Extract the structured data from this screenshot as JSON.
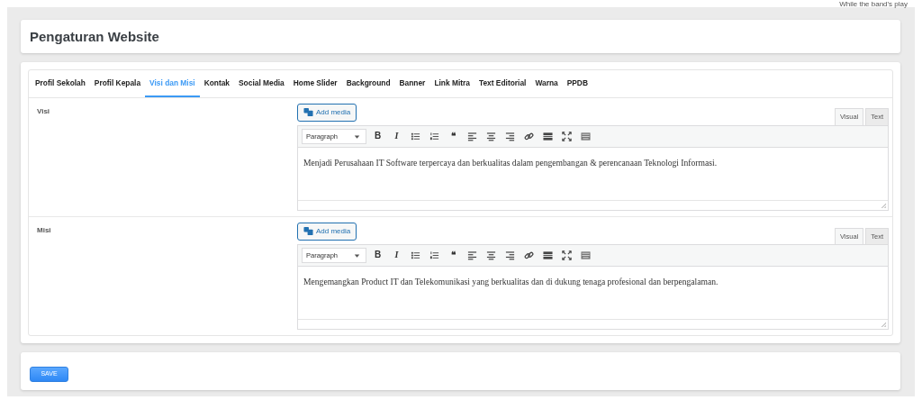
{
  "corner_note": "While the band's play",
  "header": {
    "title": "Pengaturan Website"
  },
  "tabs": [
    {
      "label": "Profil Sekolah",
      "selected": false
    },
    {
      "label": "Profil Kepala",
      "selected": false
    },
    {
      "label": "Visi dan Misi",
      "selected": true
    },
    {
      "label": "Kontak",
      "selected": false
    },
    {
      "label": "Social Media",
      "selected": false
    },
    {
      "label": "Home Slider",
      "selected": false
    },
    {
      "label": "Background",
      "selected": false
    },
    {
      "label": "Banner",
      "selected": false
    },
    {
      "label": "Link Mitra",
      "selected": false
    },
    {
      "label": "Text Editorial",
      "selected": false
    },
    {
      "label": "Warna",
      "selected": false
    },
    {
      "label": "PPDB",
      "selected": false
    }
  ],
  "fields": [
    {
      "label": "Visi",
      "add_media": "Add media",
      "format": "Paragraph",
      "modes": [
        {
          "label": "Visual",
          "selected": true
        },
        {
          "label": "Text",
          "selected": false
        }
      ],
      "toolbar": [
        {
          "kind": "bold",
          "label": "B"
        },
        {
          "kind": "italic",
          "label": "I"
        },
        {
          "kind": "bullet-list"
        },
        {
          "kind": "number-list"
        },
        {
          "kind": "quote",
          "label": "❝"
        },
        {
          "kind": "align-left"
        },
        {
          "kind": "align-center"
        },
        {
          "kind": "align-right"
        },
        {
          "kind": "link"
        },
        {
          "kind": "more"
        },
        {
          "kind": "fullscreen"
        },
        {
          "kind": "toolbar-toggle"
        }
      ],
      "content": "Menjadi Perusahaan IT Software terpercaya dan berkualitas dalam pengembangan & perencanaan Teknologi Informasi."
    },
    {
      "label": "Misi",
      "add_media": "Add media",
      "format": "Paragraph",
      "modes": [
        {
          "label": "Visual",
          "selected": true
        },
        {
          "label": "Text",
          "selected": false
        }
      ],
      "toolbar": [
        {
          "kind": "bold",
          "label": "B"
        },
        {
          "kind": "italic",
          "label": "I"
        },
        {
          "kind": "bullet-list"
        },
        {
          "kind": "number-list"
        },
        {
          "kind": "quote",
          "label": "❝"
        },
        {
          "kind": "align-left"
        },
        {
          "kind": "align-center"
        },
        {
          "kind": "align-right"
        },
        {
          "kind": "link"
        },
        {
          "kind": "more"
        },
        {
          "kind": "fullscreen"
        },
        {
          "kind": "toolbar-toggle"
        }
      ],
      "content": "Mengemangkan Product IT dan Telekomunikasi yang berkualitas dan di dukung tenaga profesional dan berpengalaman."
    }
  ],
  "save_button": "SAVE"
}
